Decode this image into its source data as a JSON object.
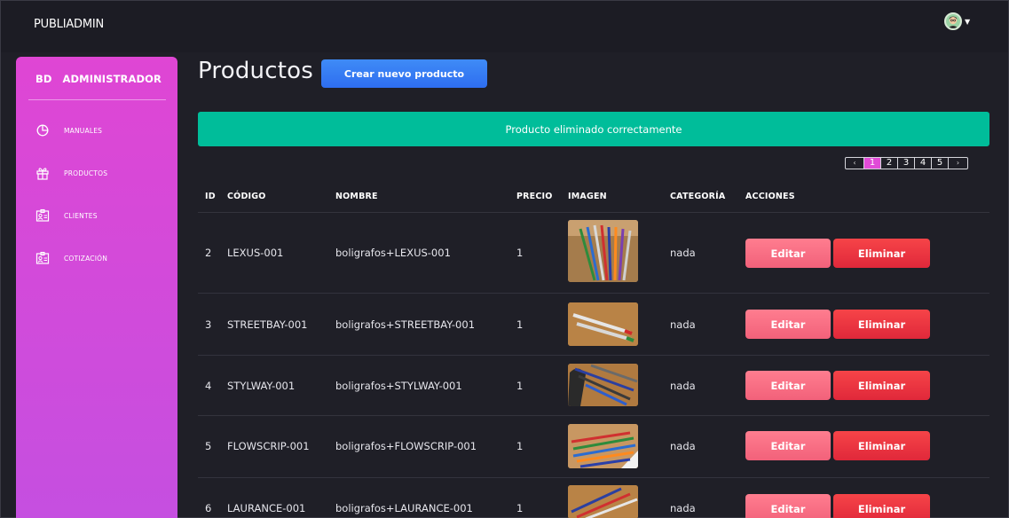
{
  "app": {
    "brand": "PUBLIADMIN"
  },
  "user": {
    "avatar_icon": "user-avatar-icon",
    "menu_icon": "caret-down-icon"
  },
  "sidebar": {
    "bd": "BD",
    "title": "ADMINISTRADOR",
    "items": [
      {
        "label": "MANUALES",
        "icon": "pie-chart-icon"
      },
      {
        "label": "PRODUCTOS",
        "icon": "gift-icon"
      },
      {
        "label": "CLIENTES",
        "icon": "contact-card-icon"
      },
      {
        "label": "COTIZACIÓN",
        "icon": "contact-card-icon"
      }
    ]
  },
  "page": {
    "title": "Productos",
    "new_button": "Crear nuevo producto",
    "alert": "Producto eliminado correctamente"
  },
  "pagination": {
    "prev": "‹",
    "pages": [
      "1",
      "2",
      "3",
      "4",
      "5"
    ],
    "next": "›",
    "active": "1"
  },
  "table": {
    "headers": [
      "ID",
      "CÓDIGO",
      "NOMBRE",
      "PRECIO",
      "IMAGEN",
      "CATEGORÍA",
      "ACCIONES"
    ],
    "rows": [
      {
        "id": "2",
        "codigo": "LEXUS-001",
        "nombre": "boligrafos+LEXUS-001",
        "precio": "1",
        "categoria": "nada",
        "edit": "Editar",
        "delete": "Eliminar"
      },
      {
        "id": "3",
        "codigo": "STREETBAY-001",
        "nombre": "boligrafos+STREETBAY-001",
        "precio": "1",
        "categoria": "nada",
        "edit": "Editar",
        "delete": "Eliminar"
      },
      {
        "id": "4",
        "codigo": "STYLWAY-001",
        "nombre": "boligrafos+STYLWAY-001",
        "precio": "1",
        "categoria": "nada",
        "edit": "Editar",
        "delete": "Eliminar"
      },
      {
        "id": "5",
        "codigo": "FLOWSCRIP-001",
        "nombre": "boligrafos+FLOWSCRIP-001",
        "precio": "1",
        "categoria": "nada",
        "edit": "Editar",
        "delete": "Eliminar"
      },
      {
        "id": "6",
        "codigo": "LAURANCE-001",
        "nombre": "boligrafos+LAURANCE-001",
        "precio": "1",
        "categoria": "nada",
        "edit": "Editar",
        "delete": "Eliminar"
      }
    ]
  },
  "colors": {
    "sidebar_top": "#df46d4",
    "sidebar_bottom": "#c54fe0",
    "alert": "#00bd9a",
    "primary": "#2e6ef0",
    "edit": "#f2617a",
    "delete": "#e0283a"
  }
}
